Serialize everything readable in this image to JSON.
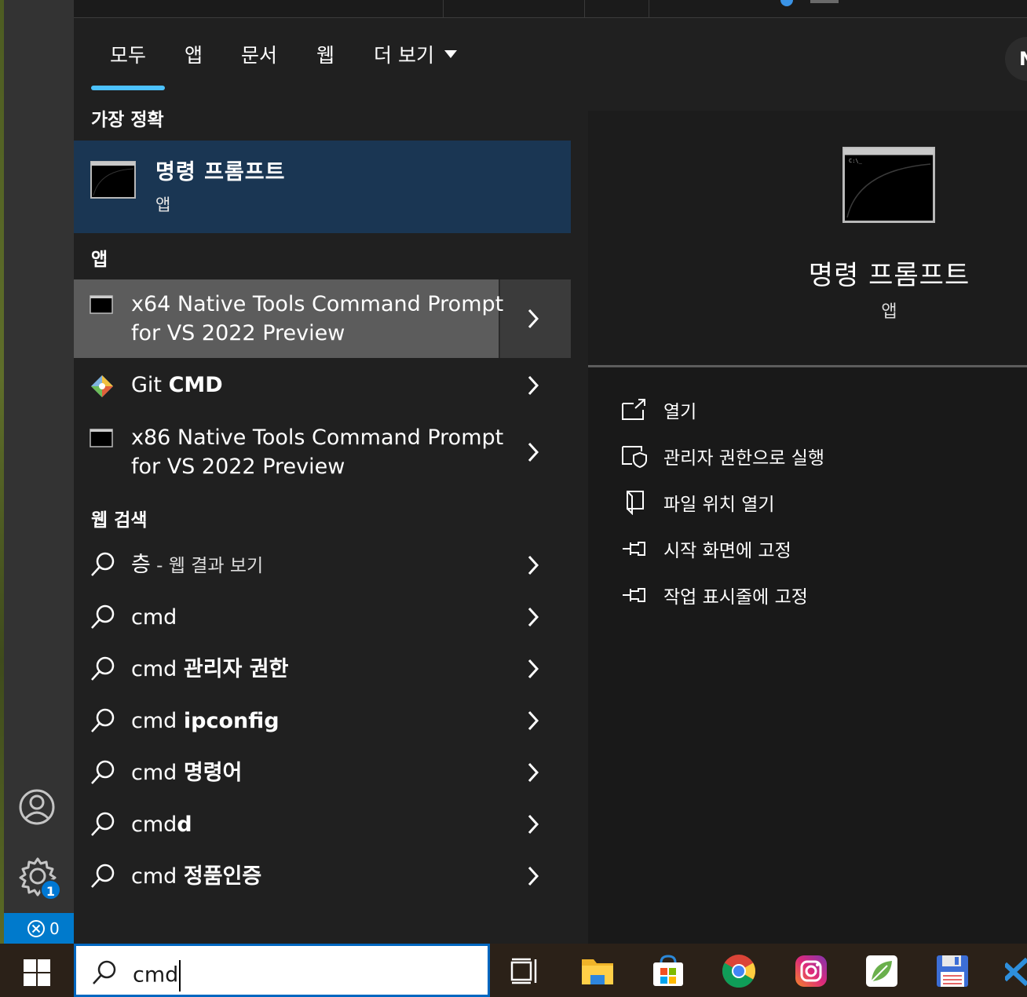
{
  "tabs": [
    "모두",
    "앱",
    "문서",
    "웹",
    "더 보기"
  ],
  "profile_initial": "N",
  "sections": {
    "best": "가장 정확",
    "apps": "앱",
    "web": "웹 검색"
  },
  "best_match": {
    "title": "명령 프롬프트",
    "sub": "앱"
  },
  "apps": [
    {
      "line1": "x64 Native Tools Command Prompt",
      "line2": "for VS 2022 Preview"
    },
    {
      "pre": "Git ",
      "bold": "CMD"
    },
    {
      "line1": "x86 Native Tools Command Prompt",
      "line2": "for VS 2022 Preview"
    }
  ],
  "web": [
    {
      "pre": "층",
      "dim": " - 웹 결과 보기"
    },
    {
      "pre": "cmd",
      "bold": ""
    },
    {
      "pre": "cmd ",
      "bold": "관리자 권한"
    },
    {
      "pre": "cmd ",
      "bold": "ipconfig"
    },
    {
      "pre": "cmd ",
      "bold": "명령어"
    },
    {
      "pre": "cmd",
      "bold": "d"
    },
    {
      "pre": "cmd ",
      "bold": "정품인증"
    }
  ],
  "preview": {
    "title": "명령 프롬프트",
    "sub": "앱",
    "actions": [
      "열기",
      "관리자 권한으로 실행",
      "파일 위치 열기",
      "시작 화면에 고정",
      "작업 표시줄에 고정"
    ]
  },
  "vscode": {
    "settings_badge": "1",
    "problems_count": "0"
  },
  "search_query": "cmd",
  "colors": {
    "accent": "#4cc2ff",
    "selected": "#1a3653",
    "taskbar_search_border": "#0067c0"
  }
}
